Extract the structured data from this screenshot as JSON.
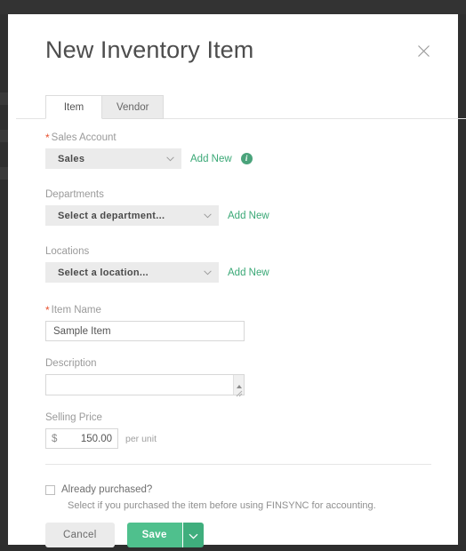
{
  "modal": {
    "title": "New Inventory Item",
    "close_icon": "close-icon"
  },
  "tabs": [
    {
      "label": "Item",
      "active": true
    },
    {
      "label": "Vendor",
      "active": false
    }
  ],
  "form": {
    "sales_account": {
      "label": "Sales Account",
      "required": true,
      "value": "Sales",
      "add_new": "Add New",
      "info_icon": "i"
    },
    "departments": {
      "label": "Departments",
      "required": false,
      "value": "Select a department...",
      "add_new": "Add New"
    },
    "locations": {
      "label": "Locations",
      "required": false,
      "value": "Select a location...",
      "add_new": "Add New"
    },
    "item_name": {
      "label": "Item Name",
      "required": true,
      "value": "Sample Item",
      "placeholder": ""
    },
    "description": {
      "label": "Description",
      "required": false,
      "value": "",
      "placeholder": ""
    },
    "selling_price": {
      "label": "Selling Price",
      "required": false,
      "currency": "$",
      "value": "150.00",
      "suffix": "per unit"
    }
  },
  "footer": {
    "already_purchased_label": "Already purchased?",
    "already_purchased_checked": false,
    "help_text": "Select if you purchased the item before using FINSYNC for accounting.",
    "cancel_label": "Cancel",
    "save_label": "Save",
    "save_caret_icon": "chevron-down-icon"
  },
  "colors": {
    "accent_green": "#3aa876",
    "save_green": "#4fc08d",
    "save_caret_green": "#3fae7d",
    "required_red": "#e8512f",
    "field_gray": "#ebebeb",
    "chrome_dark": "#2e2e2e"
  }
}
